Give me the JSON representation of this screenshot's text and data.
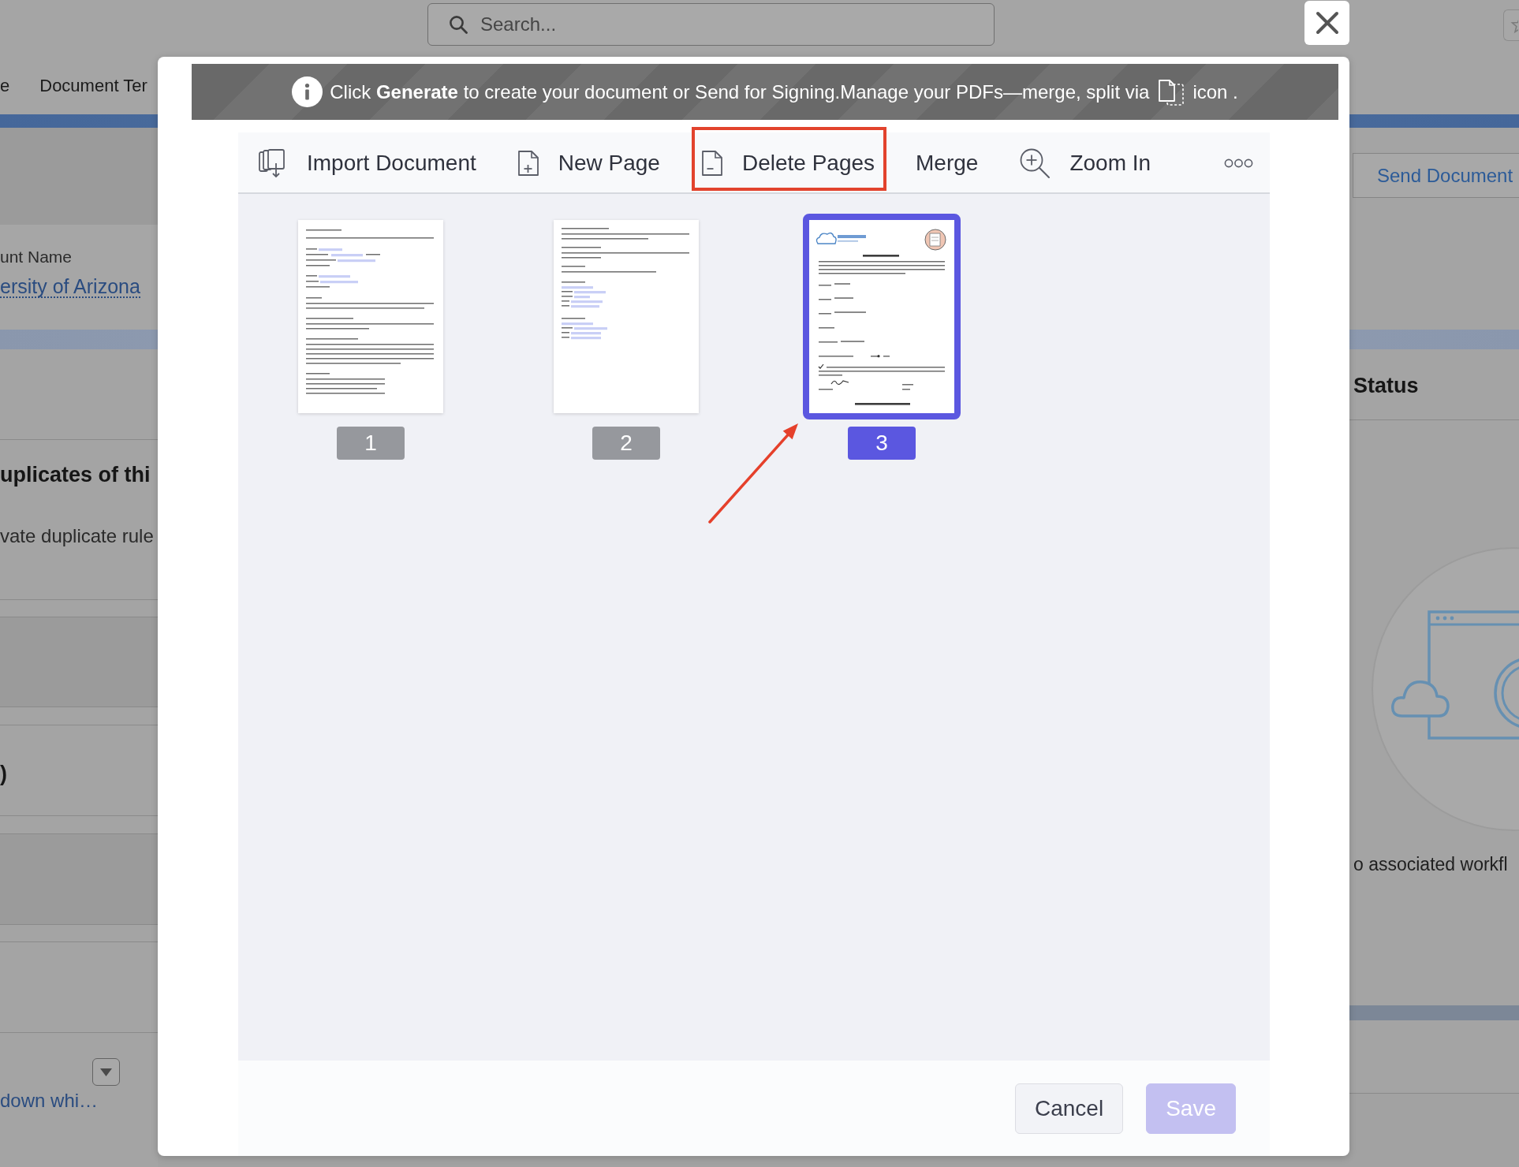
{
  "background": {
    "search": {
      "placeholder": "Search..."
    },
    "nav_items": [
      {
        "label": "e"
      },
      {
        "label": "Document Ter"
      }
    ],
    "account": {
      "label": "unt Name",
      "value": "ersity of Arizona"
    },
    "duplicates": {
      "heading": "uplicates of thi",
      "text": "vate duplicate rule"
    },
    "section_heading": ")",
    "dropdown_link": "down whi…",
    "send_button": "Send Document",
    "status": {
      "heading": "Status",
      "text": "o associated workfl"
    }
  },
  "dialog": {
    "banner": {
      "message": "Click **Generate** to create your document or Send for Signing.Manage your PDFs—merge, split via",
      "suffix": "icon ."
    },
    "toolbar": [
      {
        "kind": "import",
        "label": "Import Document",
        "highlighted": false
      },
      {
        "kind": "new",
        "label": "New Page",
        "highlighted": false
      },
      {
        "kind": "delete",
        "label": "Delete Pages",
        "highlighted": true
      },
      {
        "kind": "merge",
        "label": "Merge",
        "highlighted": false
      },
      {
        "kind": "zoom",
        "label": "Zoom In",
        "highlighted": false
      },
      {
        "kind": "more",
        "highlighted": false
      }
    ],
    "pages": [
      {
        "label": "1",
        "kind": "text",
        "selected": false,
        "pointed_at": false
      },
      {
        "label": "2",
        "kind": "fields",
        "selected": false,
        "pointed_at": false
      },
      {
        "label": "3",
        "kind": "form",
        "selected": true,
        "pointed_at": true
      }
    ],
    "buttons": [
      {
        "kind": "secondary",
        "label": "Cancel",
        "disabled": false
      },
      {
        "kind": "primary",
        "label": "Save",
        "disabled": true
      }
    ]
  }
}
